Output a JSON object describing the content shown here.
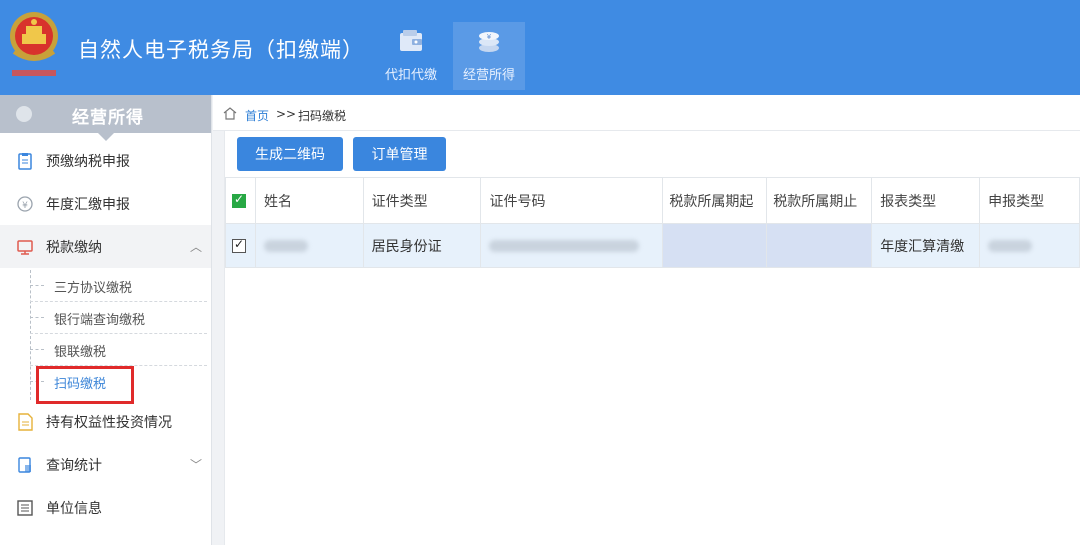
{
  "header": {
    "title": "自然人电子税务局（扣缴端）",
    "nav": [
      {
        "label": "代扣代缴",
        "icon": "wallet-icon",
        "active": false
      },
      {
        "label": "经营所得",
        "icon": "coins-icon",
        "active": true
      }
    ]
  },
  "sidebar": {
    "title": "经营所得",
    "items": [
      {
        "label": "预缴纳税申报",
        "icon": "clipboard-icon"
      },
      {
        "label": "年度汇缴申报",
        "icon": "yuan-coin-icon"
      },
      {
        "label": "税款缴纳",
        "icon": "monitor-icon",
        "expanded": true
      },
      {
        "label": "持有权益性投资情况",
        "icon": "document-icon"
      },
      {
        "label": "查询统计",
        "icon": "report-icon"
      },
      {
        "label": "单位信息",
        "icon": "list-icon"
      }
    ],
    "subitems": [
      {
        "label": "三方协议缴税"
      },
      {
        "label": "银行端查询缴税"
      },
      {
        "label": "银联缴税"
      },
      {
        "label": "扫码缴税",
        "current": true
      }
    ]
  },
  "breadcrumb": {
    "home": "首页",
    "separator": ">>",
    "current": "扫码缴税"
  },
  "toolbar": {
    "generate_qr": "生成二维码",
    "order_management": "订单管理"
  },
  "table": {
    "columns": [
      "姓名",
      "证件类型",
      "证件号码",
      "税款所属期起",
      "税款所属期止",
      "报表类型",
      "申报类型"
    ],
    "rows": [
      {
        "checked": true,
        "name": "",
        "id_type": "居民身份证",
        "id_number": "",
        "period_start": "",
        "period_end": "",
        "report_type": "年度汇算清缴",
        "declare_type": ""
      }
    ]
  },
  "colors": {
    "header_bg": "#3f8be3",
    "button_bg": "#3a86de",
    "row_selected_bg": "#e7f1fb",
    "highlight_border": "#e02a2a"
  }
}
